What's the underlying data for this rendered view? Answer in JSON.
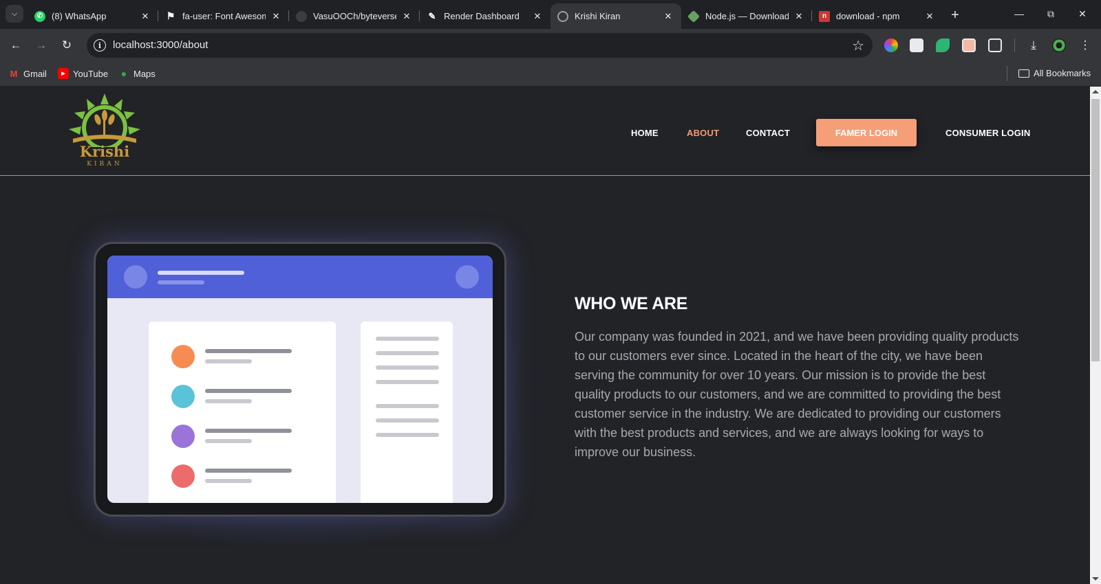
{
  "browser": {
    "tabs": [
      {
        "title": "(8) WhatsApp",
        "icon": "whatsapp-icon",
        "color": "#25d366"
      },
      {
        "title": "fa-user: Font Awesome",
        "icon": "flag-icon",
        "color": "#ffffff"
      },
      {
        "title": "VasuOOCh/byteverse",
        "icon": "github-icon",
        "color": "#3c3d41"
      },
      {
        "title": "Render Dashboard",
        "icon": "render-icon",
        "color": "#ffffff"
      },
      {
        "title": "Krishi Kiran",
        "icon": "globe-icon",
        "color": "#9aa0a6",
        "active": true
      },
      {
        "title": "Node.js — Download",
        "icon": "nodejs-icon",
        "color": "#68a063"
      },
      {
        "title": "download - npm",
        "icon": "npm-icon",
        "color": "#cb3837"
      }
    ],
    "url": "localhost:3000/about",
    "bookmarks": [
      {
        "label": "Gmail",
        "icon": "gmail-icon"
      },
      {
        "label": "YouTube",
        "icon": "youtube-icon"
      },
      {
        "label": "Maps",
        "icon": "maps-icon"
      }
    ],
    "all_bookmarks": "All Bookmarks"
  },
  "site": {
    "logo_text": "Krishi",
    "logo_subtext": "KIRAN",
    "nav": {
      "home": "HOME",
      "about": "ABOUT",
      "contact": "CONTACT",
      "farmer_login": "FAMER LOGIN",
      "consumer_login": "CONSUMER LOGIN"
    },
    "accent_color": "#f59e78",
    "about": {
      "title": "WHO WE ARE",
      "body": "Our company was founded in 2021, and we have been providing quality products to our customers ever since. Located in the heart of the city, we have been serving the community for over 10 years. Our mission is to provide the best quality products to our customers, and we are committed to providing the best customer service in the industry. We are dedicated to providing our customers with the best products and services, and we are always looking for ways to improve our business."
    }
  }
}
